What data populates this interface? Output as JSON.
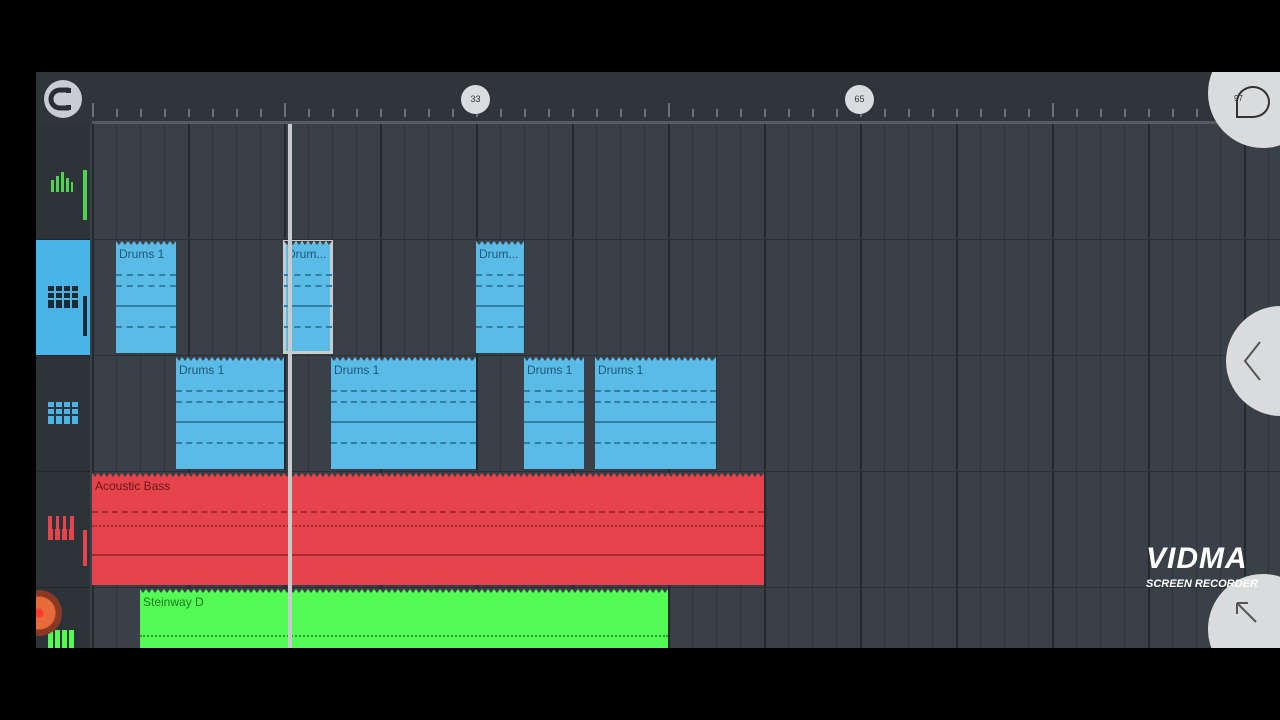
{
  "toolbar": {
    "magnet": "magnet-icon"
  },
  "timeline": {
    "markers": [
      "33",
      "65",
      "97"
    ]
  },
  "tracks": [
    {
      "icon": "meter-icon",
      "color": "#4fd44f"
    },
    {
      "icon": "drum-pads-icon",
      "color": "#1e2a33",
      "selected": true
    },
    {
      "icon": "drum-pads-icon",
      "color": "#49b4e8"
    },
    {
      "icon": "piano-icon",
      "color": "#e5444c"
    },
    {
      "icon": "piano-icon",
      "color": "#54fb54"
    }
  ],
  "clips": {
    "drums1_a": "Drums 1",
    "drums1_b": "Drum...",
    "drums1_c": "Drum...",
    "drums2_a": "Drums 1",
    "drums2_b": "Drums 1",
    "drums2_c": "Drums 1",
    "drums2_d": "Drums 1",
    "bass": "Acoustic Bass",
    "piano": "Steinway D"
  },
  "watermark": {
    "brand": "VIDMA",
    "subtitle": "SCREEN RECORDER"
  },
  "colors": {
    "drums": "#5bbbe7",
    "bass": "#e5444c",
    "piano": "#54fb54",
    "background": "#3a4048"
  }
}
